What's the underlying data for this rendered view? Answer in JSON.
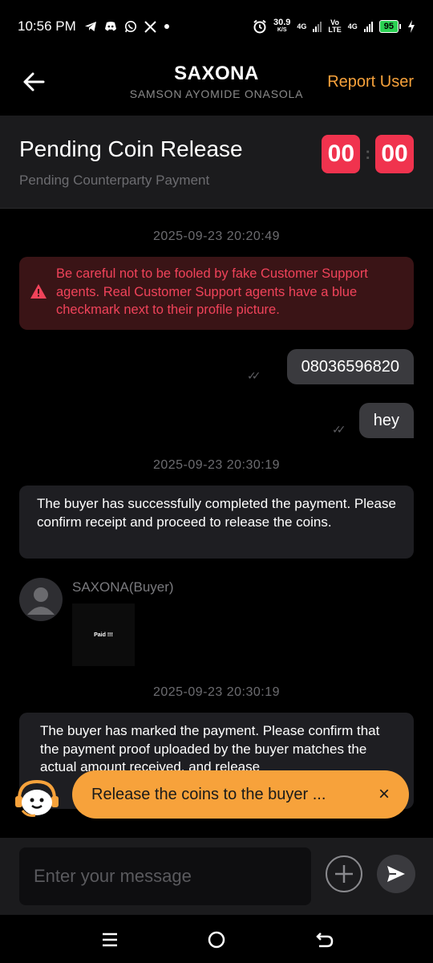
{
  "status_bar": {
    "time": "10:56 PM",
    "speed_value": "30.9",
    "speed_unit": "K/S",
    "net1": "4G",
    "net2_top": "Vo",
    "net2_bottom": "LTE",
    "net3": "4G",
    "battery": "95",
    "icons_left": [
      "telegram-icon",
      "discord-icon",
      "whatsapp-icon",
      "x-icon",
      "dot-icon"
    ],
    "icons_right": [
      "alarm-icon",
      "signal-icon",
      "signal-icon",
      "battery-icon",
      "charging-icon"
    ]
  },
  "header": {
    "title": "SAXONA",
    "subtitle": "SAMSON AYOMIDE ONASOLA",
    "report_label": "Report User"
  },
  "order": {
    "title": "Pending Coin Release",
    "status": "Pending Counterparty Payment",
    "timer_minutes": "00",
    "timer_seconds": "00",
    "timer_separator": ":"
  },
  "chat": {
    "stamp1": "2025-09-23 20:20:49",
    "warning": "Be careful not to be fooled by fake Customer Support agents. Real Customer Support agents have a blue checkmark next to their profile picture.",
    "out1": "08036596820",
    "out2": "hey",
    "stamp2": "2025-09-23 20:30:19",
    "system1": "The buyer has successfully completed the payment. Please confirm receipt and proceed to release the coins.",
    "buyer_name": "SAXONA(Buyer)",
    "proof_text": "Paid !!!",
    "stamp3": "2025-09-23 20:30:19",
    "system2": "The buyer has marked the payment. Please confirm that the payment proof uploaded by the buyer matches the actual amount received, and release"
  },
  "toast": {
    "text": "Release the coins to the buyer ...",
    "close": "×"
  },
  "composer": {
    "placeholder": "Enter your message"
  },
  "colors": {
    "accent": "#f7a23b",
    "timer": "#f0334e",
    "warning_text": "#f0435a",
    "warning_bg": "#3a1416"
  }
}
